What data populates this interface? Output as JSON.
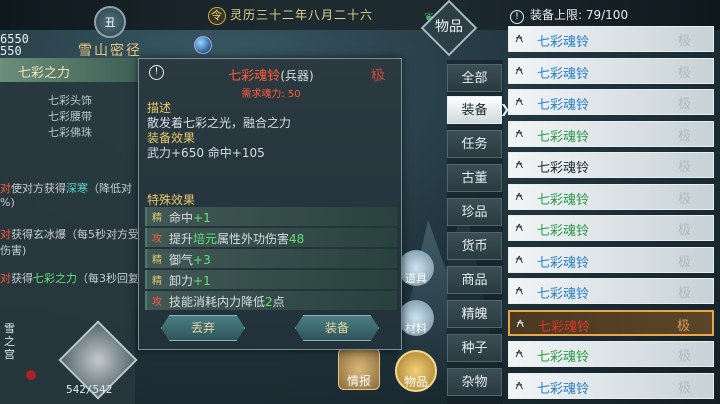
{
  "topbar": {
    "stat_top": "6550",
    "stat_bottom": "550",
    "season_icon": "丑",
    "date_icon": "令",
    "date": "灵历三十二年八月二十六",
    "location": "雪山密径"
  },
  "left_panel": {
    "title": "七彩之力",
    "items": [
      "七彩头饰",
      "七彩腰带",
      "七彩佛珠"
    ],
    "lines": [
      {
        "prefix": "对",
        "pre": "使对方获得",
        "hl": "深寒",
        "post": "（降低对"
      },
      {
        "prefix": "",
        "pre": "%)",
        "hl": "",
        "post": ""
      },
      {
        "prefix": "对",
        "pre": "获得玄冰爆",
        "hl": "",
        "post": "（每5秒对方受"
      },
      {
        "prefix": "",
        "pre": "伤害)",
        "hl": "",
        "post": ""
      },
      {
        "prefix": "对",
        "pre": "获得",
        "hl": "七彩之力",
        "post": "（每3秒回复"
      }
    ],
    "char_label": "雪之宫",
    "hp": "542/542"
  },
  "popup": {
    "item_name": "七彩魂铃",
    "item_type": "(兵器)",
    "requirement": "需求魂力: 50",
    "grade_mark": "极",
    "desc_heading": "描述",
    "desc_text": "散发着七彩之光，融合之力",
    "equip_heading": "装备效果",
    "equip_text": "武力+650  命中+105",
    "special_heading": "特殊效果",
    "effects": [
      {
        "tag": "精",
        "pre": "命中",
        "hl": "+1",
        "post": ""
      },
      {
        "tag": "攻",
        "pre": "提升",
        "hl": "培元",
        "post": "属性外功伤害",
        "num": "48"
      },
      {
        "tag": "精",
        "pre": "御气",
        "hl": "+3",
        "post": ""
      },
      {
        "tag": "精",
        "pre": "卸力",
        "hl": "+1",
        "post": ""
      },
      {
        "tag": "攻",
        "pre": "技能消耗内力降低",
        "hl": "2",
        "post": "点"
      }
    ],
    "discard_label": "丢弃",
    "equip_label": "装备"
  },
  "bottom_icons": {
    "qingbao": "情报",
    "wupin": "物品",
    "daoju": "道具",
    "cailiao": "材料"
  },
  "inventory": {
    "panel_label": "物品",
    "capacity_label": "装备上限: 79/100",
    "tabs": [
      "全部",
      "装备",
      "任务",
      "古董",
      "珍品",
      "货币",
      "商品",
      "精魄",
      "种子",
      "杂物"
    ],
    "active_tab": "装备",
    "rows": [
      {
        "name": "七彩魂铃",
        "quality": "blue"
      },
      {
        "name": "七彩魂铃",
        "quality": "blue"
      },
      {
        "name": "七彩魂铃",
        "quality": "blue"
      },
      {
        "name": "七彩魂铃",
        "quality": "green"
      },
      {
        "name": "七彩魂铃",
        "quality": "dark"
      },
      {
        "name": "七彩魂铃",
        "quality": "green"
      },
      {
        "name": "七彩魂铃",
        "quality": "green"
      },
      {
        "name": "七彩魂铃",
        "quality": "blue"
      },
      {
        "name": "七彩魂铃",
        "quality": "blue"
      },
      {
        "name": "七彩魂铃",
        "quality": "red",
        "selected": true
      },
      {
        "name": "七彩魂铃",
        "quality": "green"
      },
      {
        "name": "七彩魂铃",
        "quality": "blue"
      }
    ],
    "grade_mark": "极",
    "bell_icon": "bell-icon"
  }
}
